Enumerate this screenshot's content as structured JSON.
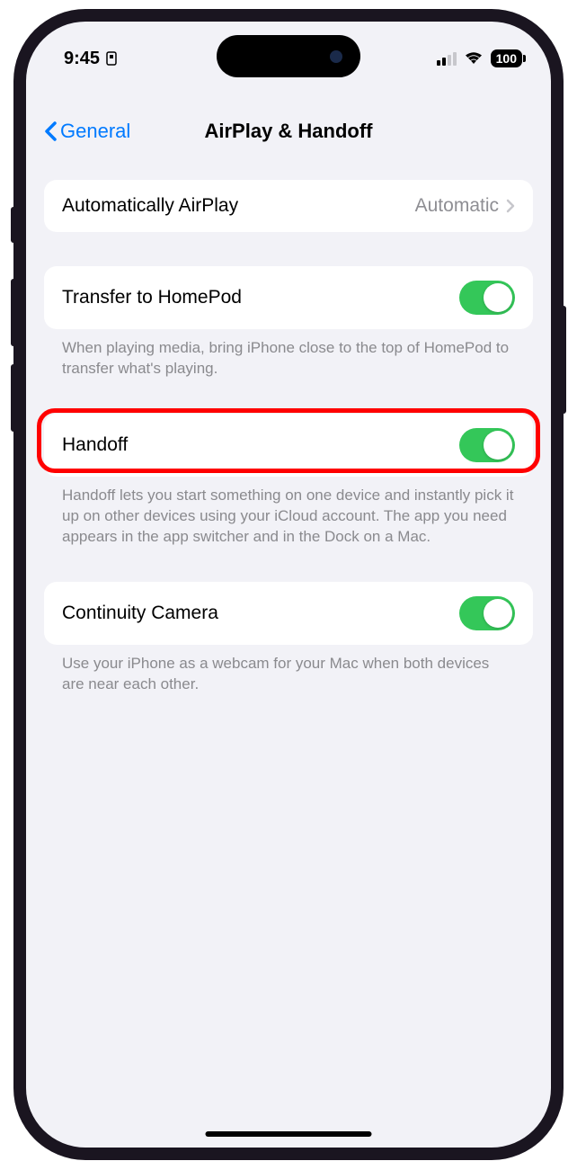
{
  "status": {
    "time": "9:45",
    "battery": "100"
  },
  "nav": {
    "back_label": "General",
    "title": "AirPlay & Handoff"
  },
  "sections": {
    "auto_airplay": {
      "label": "Automatically AirPlay",
      "value": "Automatic"
    },
    "transfer_homepod": {
      "label": "Transfer to HomePod",
      "footer": "When playing media, bring iPhone close to the top of HomePod to transfer what's playing."
    },
    "handoff": {
      "label": "Handoff",
      "footer": "Handoff lets you start something on one device and instantly pick it up on other devices using your iCloud account. The app you need appears in the app switcher and in the Dock on a Mac."
    },
    "continuity": {
      "label": "Continuity Camera",
      "footer": "Use your iPhone as a webcam for your Mac when both devices are near each other."
    }
  }
}
